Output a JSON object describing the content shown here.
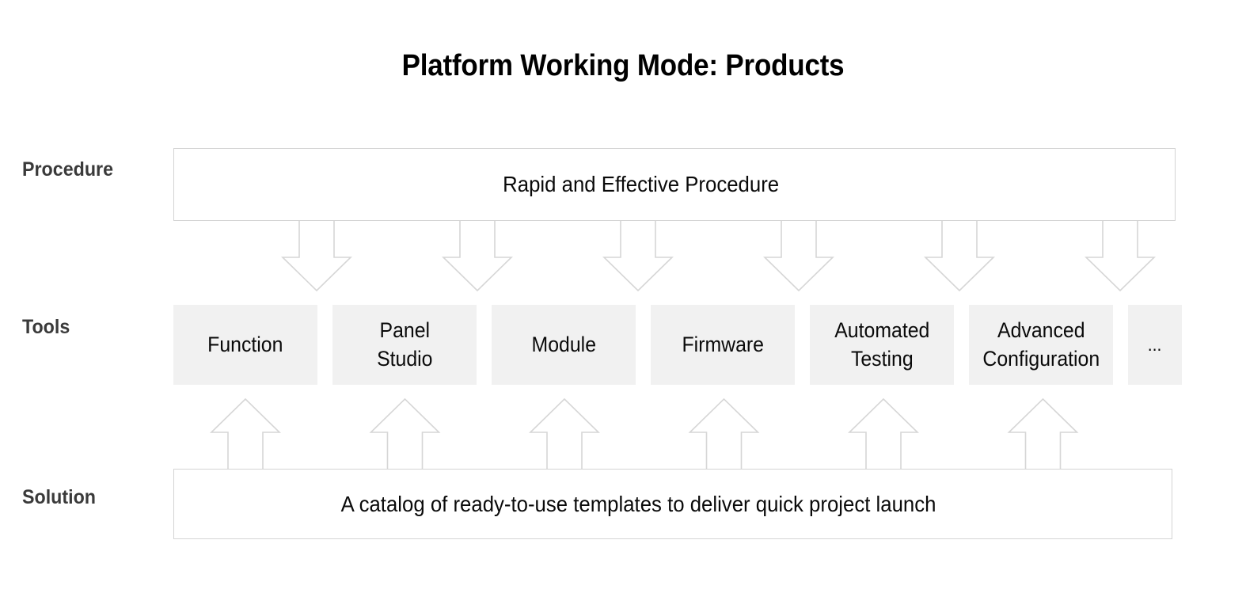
{
  "title": "Platform Working Mode: Products",
  "rows": {
    "procedure": {
      "label": "Procedure",
      "text": "Rapid and Effective Procedure"
    },
    "tools": {
      "label": "Tools"
    },
    "solution": {
      "label": "Solution",
      "text": "A catalog of ready-to-use templates to deliver quick project launch"
    }
  },
  "tools": [
    {
      "label": "Function"
    },
    {
      "label": "Panel\nStudio"
    },
    {
      "label": "Module"
    },
    {
      "label": "Firmware"
    },
    {
      "label": "Automated\nTesting"
    },
    {
      "label": "Advanced\nConfiguration"
    },
    {
      "label": "..."
    }
  ],
  "colors": {
    "background": "#ffffff",
    "title_text": "#000000",
    "row_label_text": "#3a3a3a",
    "band_border": "#d4d4d4",
    "band_fill": "#ffffff",
    "tool_fill": "#f1f1f1",
    "tool_text": "#0a0a0a",
    "arrow_stroke": "#d6d6d6",
    "arrow_fill": "#ffffff"
  },
  "flow": {
    "down_arrow_count": 6,
    "down_arrow_direction": "down",
    "down_arrow_from": "Rapid and Effective Procedure",
    "down_arrow_to": "Tools",
    "up_arrow_count": 6,
    "up_arrow_direction": "up",
    "up_arrow_from": "A catalog of ready-to-use templates to deliver quick project launch",
    "up_arrow_to": "Tools"
  }
}
